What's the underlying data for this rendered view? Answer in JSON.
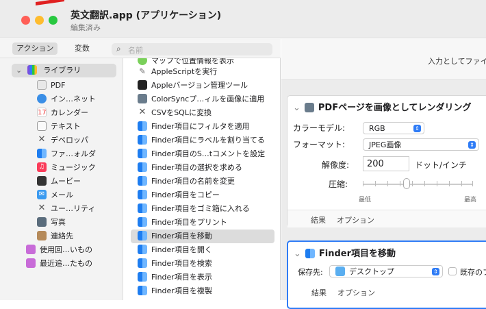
{
  "window": {
    "title": "英文翻訳.app (アプリケーション)",
    "subtitle": "編集済み"
  },
  "toolbar": {
    "tab_actions": "アクション",
    "tab_variables": "変数",
    "search_placeholder": "名前"
  },
  "library": {
    "root": "ライブラリ",
    "items": [
      "PDF",
      "インターネット",
      "カレンダー",
      "テキスト",
      "デベロッパ",
      "ファイルとフォルダ",
      "ミュージック",
      "ムービー",
      "メール",
      "ユーティリティ",
      "写真",
      "連絡先"
    ],
    "items_display": [
      "PDF",
      "イン…ネット",
      "カレンダー",
      "テキスト",
      "デベロッパ",
      "ファ…ォルダ",
      "ミュージック",
      "ムービー",
      "メール",
      "ユー…リティ",
      "写真",
      "連絡先"
    ],
    "recent1": "使用回…いもの",
    "recent2": "最近追…たもの"
  },
  "actions": {
    "items": [
      "マップで位置情報を表示",
      "AppleScriptを実行",
      "Appleバージョン管理ツール",
      "ColorSyncプ…ィルを画像に適用",
      "CSVをSQLに変換",
      "Finder項目にフィルタを適用",
      "Finder項目にラベルを割り当てる",
      "Finder項目のS…tコメントを設定",
      "Finder項目の選択を求める",
      "Finder項目の名前を変更",
      "Finder項目をコピー",
      "Finder項目をゴミ箱に入れる",
      "Finder項目をプリント",
      "Finder項目を移動",
      "Finder項目を開く",
      "Finder項目を検索",
      "Finder項目を表示",
      "Finder項目を複製"
    ],
    "selected_index": 13
  },
  "right": {
    "input_header": "入力としてファイ",
    "card1": {
      "title": "PDFページを画像としてレンダリング",
      "color_model_label": "カラーモデル:",
      "color_model_value": "RGB",
      "format_label": "フォーマット:",
      "format_value": "JPEG画像",
      "resolution_label": "解像度:",
      "resolution_value": "200",
      "resolution_unit": "ドット/インチ",
      "compression_label": "圧縮:",
      "compression_level": 0.4,
      "min_label": "最低",
      "max_label": "最高",
      "results": "結果",
      "options": "オプション"
    },
    "card2": {
      "title": "Finder項目を移動",
      "dest_label": "保存先:",
      "dest_value": "デスクトップ",
      "replace_label": "既存のフ",
      "results": "結果",
      "options": "オプション"
    }
  }
}
